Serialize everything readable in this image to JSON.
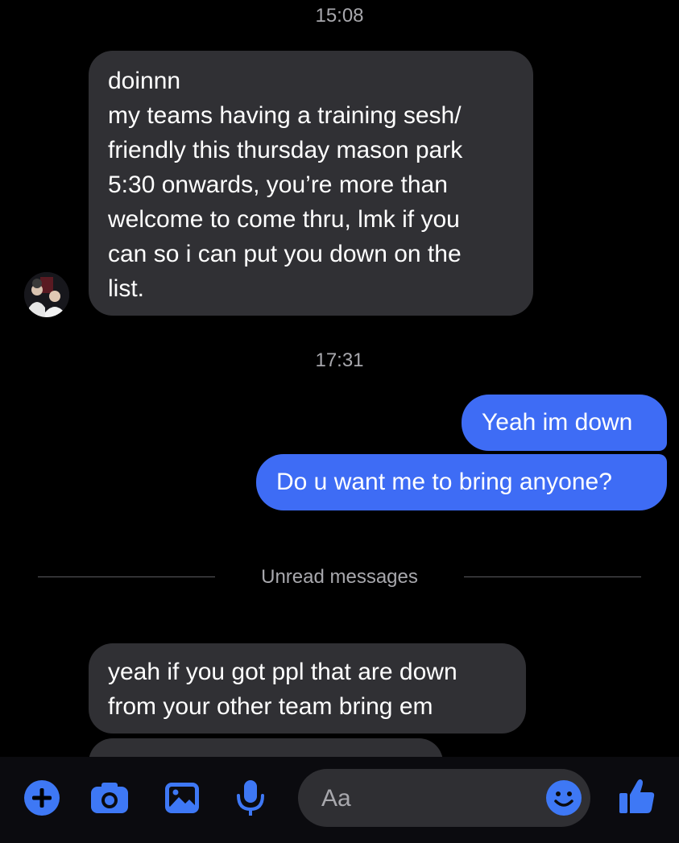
{
  "conversation": {
    "timestamps": [
      "15:08",
      "17:31"
    ],
    "messages": [
      {
        "from": "other",
        "text": "doinnn\nmy teams having a training sesh/\nfriendly this thursday mason park\n5:30 onwards, you’re more than\nwelcome to come thru, lmk if you\ncan so i can put you down on the\nlist."
      },
      {
        "from": "me",
        "text": "Yeah im down"
      },
      {
        "from": "me",
        "text": "Do u want me to bring anyone?"
      },
      {
        "from": "other",
        "text": "yeah if you got ppl that are down\nfrom your other team bring em"
      }
    ],
    "unread_label": "Unread messages"
  },
  "composer": {
    "placeholder": "Aa",
    "icons": [
      "plus-icon",
      "camera-icon",
      "image-icon",
      "microphone-icon",
      "emoji-icon",
      "thumbs-up-icon"
    ]
  },
  "colors": {
    "background": "#000000",
    "incoming_bubble": "#303034",
    "outgoing_bubble": "#3e6cf5",
    "accent": "#3e78f5",
    "muted_text": "#a8a8ad"
  }
}
